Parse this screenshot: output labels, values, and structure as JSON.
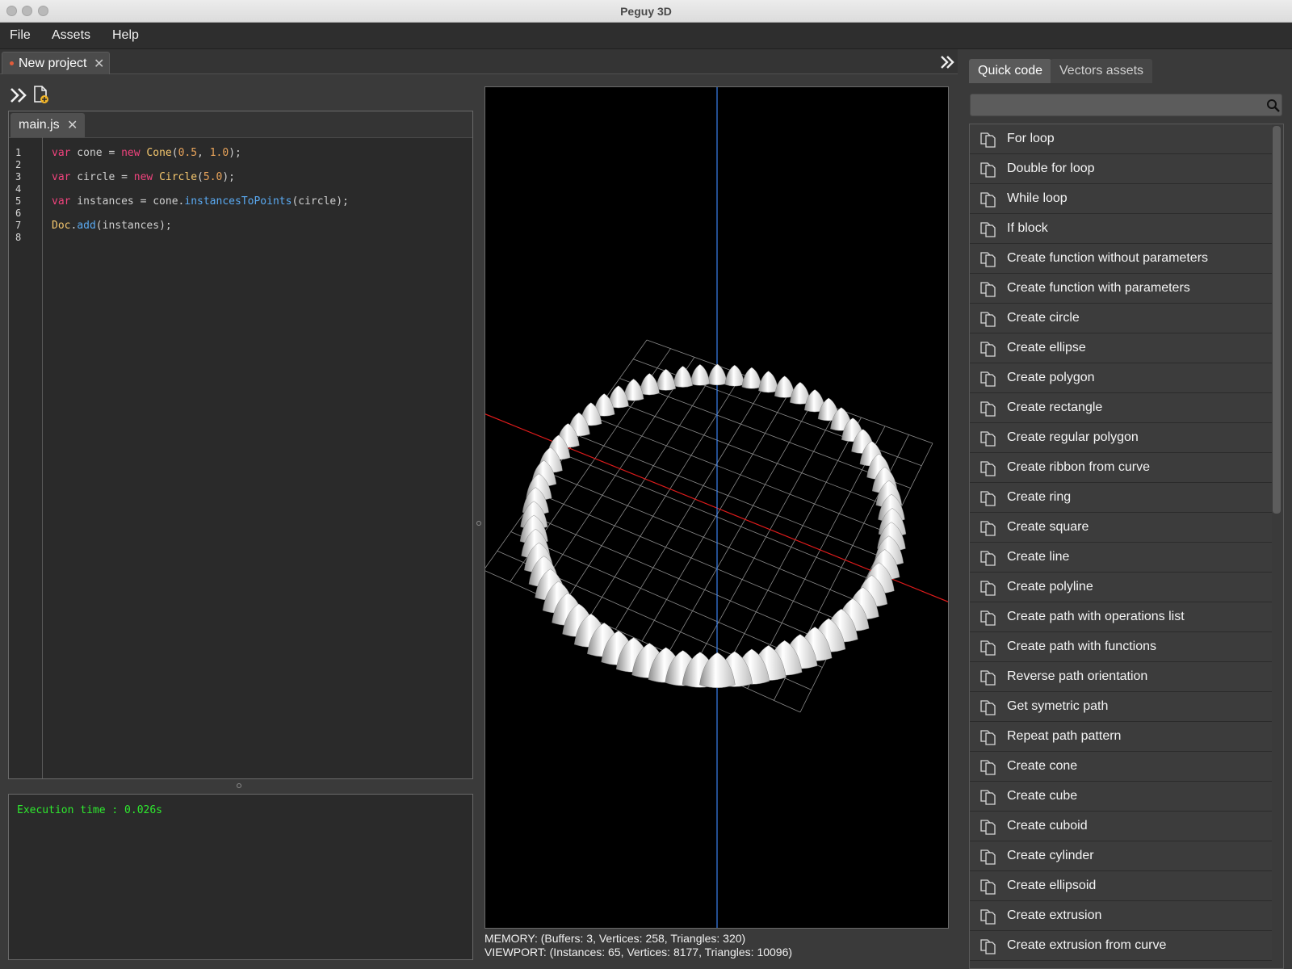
{
  "window": {
    "title": "Peguy 3D"
  },
  "menu": {
    "file": "File",
    "assets": "Assets",
    "help": "Help"
  },
  "project_tab": {
    "label": "New project"
  },
  "editor": {
    "file_tab": "main.js",
    "line_numbers": [
      "1",
      "2",
      "3",
      "4",
      "5",
      "6",
      "7",
      "8"
    ],
    "code": {
      "l1": {
        "kw": "var",
        "a": " cone = ",
        "kw2": "new",
        "b": " ",
        "cls": "Cone",
        "c": "(",
        "n1": "0.5",
        "d": ", ",
        "n2": "1.0",
        "e": ");"
      },
      "l3": {
        "kw": "var",
        "a": " circle = ",
        "kw2": "new",
        "b": " ",
        "cls": "Circle",
        "c": "(",
        "n1": "5.0",
        "e": ");"
      },
      "l5": {
        "kw": "var",
        "a": " instances = cone.",
        "fn": "instancesToPoints",
        "e": "(circle);"
      },
      "l7": {
        "cls": "Doc",
        "a": ".",
        "fn": "add",
        "e": "(instances);"
      }
    }
  },
  "console": {
    "text": "Execution time : 0.026s"
  },
  "viewport": {
    "memory": "MEMORY: (Buffers: 3, Vertices: 258, Triangles: 320)",
    "stats": "VIEWPORT: (Instances: 65, Vertices: 8177, Triangles: 10096)",
    "instance_count": 65,
    "axis_colors": {
      "x": "#e01b1b",
      "y": "#3b82f0"
    }
  },
  "right_panel": {
    "tabs": [
      "Quick code",
      "Vectors assets"
    ],
    "search_placeholder": "",
    "items": [
      "For loop",
      "Double for loop",
      "While loop",
      "If block",
      "Create function without parameters",
      "Create function with parameters",
      "Create circle",
      "Create ellipse",
      "Create polygon",
      "Create rectangle",
      "Create regular polygon",
      "Create ribbon from curve",
      "Create ring",
      "Create square",
      "Create line",
      "Create polyline",
      "Create path with operations list",
      "Create path with functions",
      "Reverse path orientation",
      "Get symetric path",
      "Repeat path pattern",
      "Create cone",
      "Create cube",
      "Create cuboid",
      "Create cylinder",
      "Create ellipsoid",
      "Create extrusion",
      "Create extrusion from curve"
    ]
  }
}
